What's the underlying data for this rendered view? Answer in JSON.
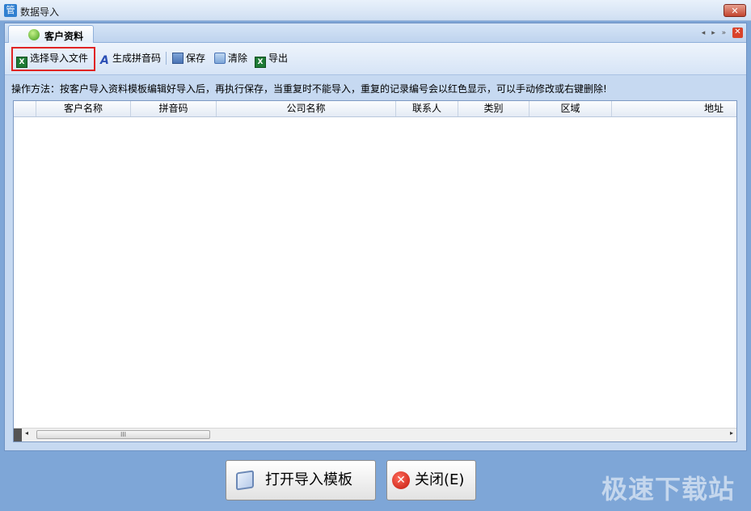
{
  "window": {
    "icon_glyph": "管",
    "title": "数据导入",
    "close_glyph": "✕"
  },
  "tab": {
    "label": "客户资料",
    "ctrl_prev": "◂",
    "ctrl_next": "▸",
    "ctrl_menu": "»",
    "close_glyph": "✕"
  },
  "toolbar": {
    "select_file": "选择导入文件",
    "gen_pinyin": "生成拼音码",
    "save": "保存",
    "clear": "清除",
    "export": "导出"
  },
  "hint": "操作方法：按客户导入资料模板编辑好导入后，再执行保存，当重复时不能导入，重复的记录编号会以红色显示，可以手动修改或右键删除!",
  "grid": {
    "columns": [
      "客户名称",
      "拼音码",
      "公司名称",
      "联系人",
      "类别",
      "区域",
      "地址"
    ]
  },
  "scrollbar": {
    "left": "◂",
    "right": "▸",
    "grip": "III"
  },
  "buttons": {
    "open_template": "打开导入模板",
    "close": "关闭(E)"
  },
  "watermark": "极速下载站",
  "icons": [
    "app-icon",
    "window-close-icon",
    "contacts-icon",
    "excel-icon",
    "font-a-icon",
    "save-disk-icon",
    "clear-icon",
    "book-icon",
    "close-x-icon"
  ]
}
